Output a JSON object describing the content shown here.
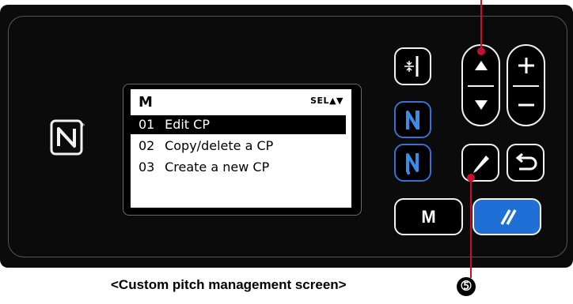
{
  "lcd": {
    "mode_label": "M",
    "sel_indicator": "SEL▲▼",
    "menu_items": [
      {
        "num": "01",
        "label": "Edit CP",
        "selected": true
      },
      {
        "num": "02",
        "label": "Copy/delete a CP",
        "selected": false
      },
      {
        "num": "03",
        "label": "Create a new CP",
        "selected": false
      }
    ]
  },
  "keys": {
    "m_key_label": "M",
    "icons": [
      "threading-icon",
      "needle-up-icon",
      "needle-down-icon",
      "arrow-up-icon",
      "arrow-down-icon",
      "plus-icon",
      "minus-icon",
      "pencil-icon",
      "return-icon",
      "reset-icon",
      "nfc-icon"
    ]
  },
  "caption": "<Custom pitch management screen>",
  "callout_number": "➄",
  "colors": {
    "panel": "#0b0b0b",
    "reset_key": "#1f6fd6",
    "callout": "#c8102e"
  }
}
